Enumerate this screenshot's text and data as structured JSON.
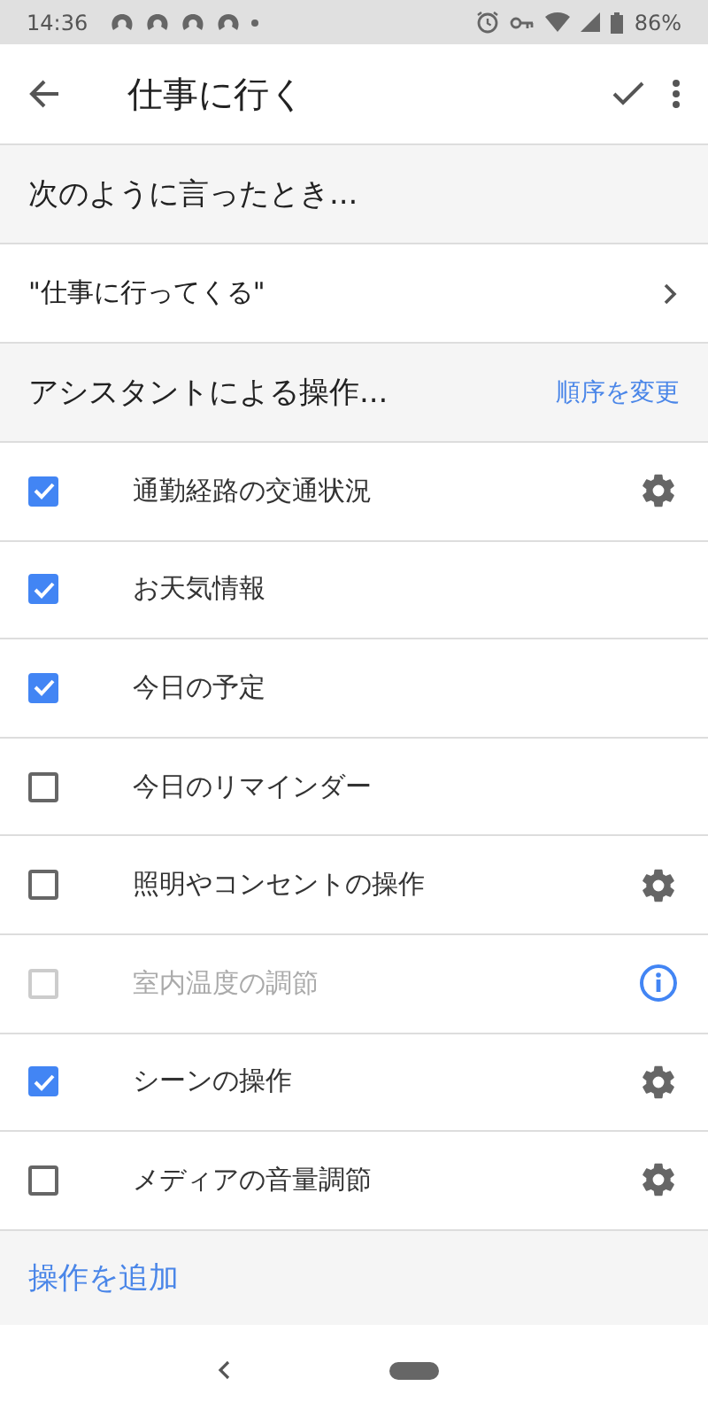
{
  "status_bar": {
    "time": "14:36",
    "battery": "86%"
  },
  "app_bar": {
    "title": "仕事に行く"
  },
  "trigger_section": {
    "heading": "次のように言ったとき..."
  },
  "trigger": {
    "phrase": "\"仕事に行ってくる\""
  },
  "actions_section": {
    "heading": "アシスタントによる操作...",
    "reorder": "順序を変更"
  },
  "actions": [
    {
      "label": "通勤経路の交通状況",
      "checked": true,
      "disabled": false,
      "kind": "settings"
    },
    {
      "label": "お天気情報",
      "checked": true,
      "disabled": false,
      "kind": "plain"
    },
    {
      "label": "今日の予定",
      "checked": true,
      "disabled": false,
      "kind": "plain"
    },
    {
      "label": "今日のリマインダー",
      "checked": false,
      "disabled": false,
      "kind": "plain"
    },
    {
      "label": "照明やコンセントの操作",
      "checked": false,
      "disabled": false,
      "kind": "settings"
    },
    {
      "label": "室内温度の調節",
      "checked": false,
      "disabled": true,
      "kind": "info"
    },
    {
      "label": "シーンの操作",
      "checked": true,
      "disabled": false,
      "kind": "settings"
    },
    {
      "label": "メディアの音量調節",
      "checked": false,
      "disabled": false,
      "kind": "settings"
    }
  ],
  "add_action": "操作を追加"
}
